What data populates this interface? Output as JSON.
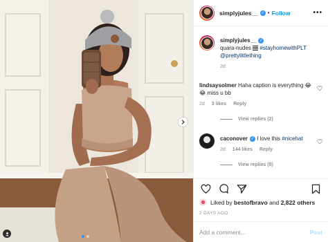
{
  "post": {
    "author": "simplyjules__",
    "follow_label": "Follow",
    "separator": "•",
    "more_label": "•••"
  },
  "caption": {
    "username": "simplyjules__",
    "text": "quara-nudes",
    "hashtag": "#stayhomewithPLT",
    "mention": "@prettylittlething",
    "age": "2d"
  },
  "comments": [
    {
      "username": "lindsaysolmer",
      "text": "Haha caption is everything 😂😂 miss u bb",
      "age": "2d",
      "likes": "3 likes",
      "reply_label": "Reply",
      "view_replies": "View replies (2)"
    },
    {
      "username": "caconover",
      "text": "I love this",
      "hashtag": "#nicehat",
      "age": "2d",
      "likes": "144 likes",
      "reply_label": "Reply",
      "view_replies": "View replies (5)"
    }
  ],
  "likes_bar": {
    "prefix": "Liked by",
    "liker": "bestofbravo",
    "conjunction": "and",
    "count": "2,822 others"
  },
  "timestamp": "2 DAYS AGO",
  "comment_box": {
    "placeholder": "Add a comment...",
    "post_label": "Post"
  },
  "icons": [
    "heart-icon",
    "comment-icon",
    "share-icon",
    "bookmark-icon",
    "more-icon",
    "verified-icon",
    "user-tag-icon",
    "chevron-right-icon"
  ],
  "colors": {
    "accent": "#0095f6",
    "verified": "#3897f0",
    "muted": "#8e8e8e",
    "post_disabled": "#b2dffc"
  }
}
